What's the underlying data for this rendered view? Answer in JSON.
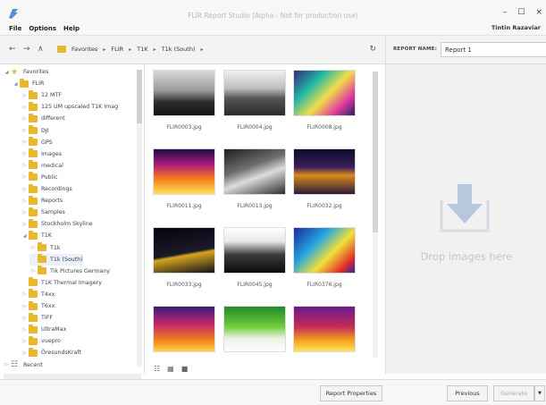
{
  "window": {
    "title": "FLIR Report Studio (Alpha - Not for production use)",
    "user": "Tintin Razaviar",
    "controls": [
      "–",
      "☐",
      "×"
    ]
  },
  "menu": [
    "File",
    "Options",
    "Help"
  ],
  "nav": {
    "back": "←",
    "forward": "→",
    "up": "∧",
    "breadcrumbs": [
      "Favorites",
      "FLIR",
      "T1K",
      "T1k (South)"
    ],
    "sep": "▸",
    "refresh": "↻"
  },
  "report": {
    "label": "REPORT NAME:",
    "name": "Report 1"
  },
  "tree": [
    {
      "label": "Favorites",
      "level": 0,
      "arrow": "◢",
      "kind": "star"
    },
    {
      "label": "FLIR",
      "level": 1,
      "arrow": "◢",
      "kind": "folder"
    },
    {
      "label": "12 MTF",
      "level": 2,
      "arrow": "▷",
      "kind": "folder"
    },
    {
      "label": "125 UM upscaled T1K Imag",
      "level": 2,
      "arrow": "▷",
      "kind": "folder"
    },
    {
      "label": "different",
      "level": 2,
      "arrow": "▷",
      "kind": "folder"
    },
    {
      "label": "DJI",
      "level": 2,
      "arrow": "▷",
      "kind": "folder"
    },
    {
      "label": "GPS",
      "level": 2,
      "arrow": "▷",
      "kind": "folder"
    },
    {
      "label": "Images",
      "level": 2,
      "arrow": "▷",
      "kind": "folder"
    },
    {
      "label": "medical",
      "level": 2,
      "arrow": "▷",
      "kind": "folder"
    },
    {
      "label": "Public",
      "level": 2,
      "arrow": "▷",
      "kind": "folder"
    },
    {
      "label": "Recordings",
      "level": 2,
      "arrow": "▷",
      "kind": "folder"
    },
    {
      "label": "Reports",
      "level": 2,
      "arrow": "▷",
      "kind": "folder"
    },
    {
      "label": "Samples",
      "level": 2,
      "arrow": "▷",
      "kind": "folder"
    },
    {
      "label": "Stockholm Skyline",
      "level": 2,
      "arrow": "▷",
      "kind": "folder"
    },
    {
      "label": "T1K",
      "level": 2,
      "arrow": "◢",
      "kind": "folder"
    },
    {
      "label": "T1k",
      "level": 3,
      "arrow": "▷",
      "kind": "folder"
    },
    {
      "label": "T1k (South)",
      "level": 3,
      "arrow": "",
      "kind": "folder"
    },
    {
      "label": "Tik Pictures Germany",
      "level": 3,
      "arrow": "▷",
      "kind": "folder"
    },
    {
      "label": "T1K Thermal Imagery",
      "level": 2,
      "arrow": "",
      "kind": "folder"
    },
    {
      "label": "T4xx",
      "level": 2,
      "arrow": "▷",
      "kind": "folder"
    },
    {
      "label": "T6xx",
      "level": 2,
      "arrow": "▷",
      "kind": "folder"
    },
    {
      "label": "TIFF",
      "level": 2,
      "arrow": "▷",
      "kind": "folder"
    },
    {
      "label": "UltraMax",
      "level": 2,
      "arrow": "▷",
      "kind": "folder"
    },
    {
      "label": "vuepro",
      "level": 2,
      "arrow": "▷",
      "kind": "folder"
    },
    {
      "label": "ÖresundsKraft",
      "level": 2,
      "arrow": "▷",
      "kind": "folder"
    },
    {
      "label": "Recent",
      "level": 0,
      "arrow": "▷",
      "kind": "recent"
    }
  ],
  "thumbnails": [
    {
      "file": "FLIR0003.jpg",
      "gradient": "linear-gradient(180deg,#d8d8d8 0%,#9a9a9a 45%,#2e2e2e 70%,#141414 100%)"
    },
    {
      "file": "FLIR0004.jpg",
      "gradient": "linear-gradient(180deg,#f0f0f0 0%,#bdbdbd 40%,#555 62%,#2a2a2a 100%)"
    },
    {
      "file": "FLIR0008.jpg",
      "gradient": "linear-gradient(135deg,#3b2a7a 0%,#1fb5a8 30%,#f0e04a 55%,#e33ca0 78%,#2a1f5c 100%)"
    },
    {
      "file": "FLIR0011.jpg",
      "gradient": "linear-gradient(180deg,#1c0d4a 0%,#b01e7a 35%,#f27a1c 65%,#ffe35a 100%)"
    },
    {
      "file": "FLIR0013.jpg",
      "gradient": "linear-gradient(160deg,#1e1e1e 0%,#6f6f6f 40%,#dcdcdc 60%,#2c2c2c 100%)"
    },
    {
      "file": "FLIR0032.jpg",
      "gradient": "linear-gradient(180deg,#0e0e2c 0%,#3b1d5a 40%,#d98a1a 58%,#2b1a3c 100%)"
    },
    {
      "file": "FLIR0033.jpg",
      "gradient": "linear-gradient(170deg,#050510 0%,#1a1a2a 55%,#d6a51c 60%,#101020 100%)"
    },
    {
      "file": "FLIR0045.jpg",
      "gradient": "linear-gradient(180deg,#ffffff 0%,#e8e8e8 30%,#3a3a3a 60%,#0c0c0c 100%)"
    },
    {
      "file": "FLIR0376.jpg",
      "gradient": "linear-gradient(135deg,#1a2aa0 0%,#25a6e0 35%,#f2e23a 60%,#e02a2a 85%,#1a2aa0 100%)"
    },
    {
      "file": "",
      "gradient": "linear-gradient(180deg,#3a1a7a 0%,#c42a6a 40%,#f2801c 75%,#ffd34a 100%)"
    },
    {
      "file": "",
      "gradient": "linear-gradient(180deg,#1f8a2a 0%,#6fcf3a 45%,#e8f0e0 70%,#ffffff 100%)"
    },
    {
      "file": "",
      "gradient": "linear-gradient(180deg,#6a1a8a 0%,#c62a5a 45%,#f4a01c 75%,#ffe45a 100%)"
    }
  ],
  "drop": {
    "text": "Drop images here",
    "color": "#b7c7dc"
  },
  "buttons": {
    "report_properties": "Report Properties",
    "previous": "Previous",
    "generate": "Generate",
    "generate_arrow": "▼"
  },
  "view_icons": [
    "☷",
    "▦",
    "■"
  ]
}
